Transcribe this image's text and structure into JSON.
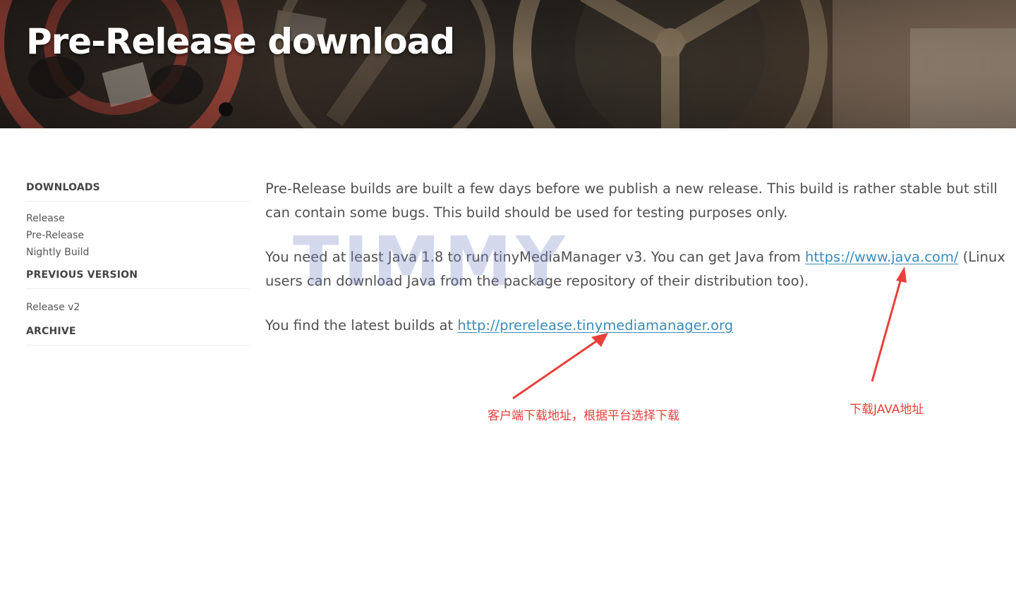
{
  "hero": {
    "title": "Pre-Release download"
  },
  "sidebar": {
    "sections": [
      {
        "heading": "DOWNLOADS",
        "items": [
          "Release",
          "Pre-Release",
          "Nightly Build"
        ]
      },
      {
        "heading": "PREVIOUS VERSION",
        "items": [
          "Release v2"
        ]
      },
      {
        "heading": "ARCHIVE",
        "items": []
      }
    ]
  },
  "content": {
    "p1": "Pre-Release builds are built a few days before we publish a new release. This build is rather stable but still can contain some bugs. This build should be used for testing purposes only.",
    "p2_before": "You need at least Java 1.8 to run tinyMediaManager v3. You can get Java from ",
    "p2_link": "https://www.java.com/",
    "p2_after": " (Linux users can download Java from the package repository of their distribution too).",
    "p3_before": "You find the latest builds at ",
    "p3_link": "http://prerelease.tinymediamanager.org"
  },
  "watermark": "TIMMY",
  "annotations": {
    "client_download": "客户端下载地址，根据平台选择下载",
    "java_download": "下载JAVA地址"
  },
  "colors": {
    "link": "#3b8bba",
    "annotation": "#e8403a"
  }
}
